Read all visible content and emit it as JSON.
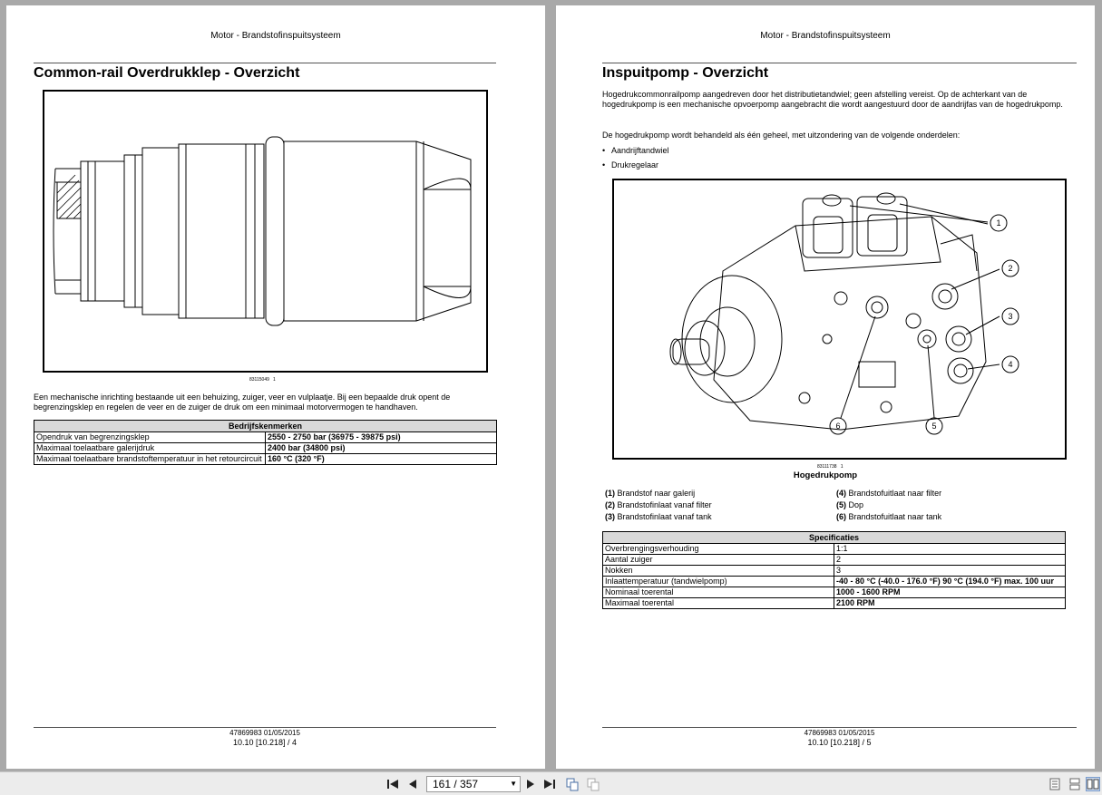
{
  "left_page": {
    "header": "Motor - Brandstofinspuitsysteem",
    "title": "Common-rail Overdrukklep - Overzicht",
    "figure_id": "83115049",
    "figure_num": "1",
    "paragraph": "Een mechanische inrichting bestaande uit een behuizing, zuiger, veer en vulplaatje. Bij een bepaalde druk opent de begrenzingsklep en regelen de veer en de zuiger de druk om een minimaal motorvermogen te handhaven.",
    "table": {
      "header": "Bedrijfskenmerken",
      "rows": [
        {
          "label": "Opendruk van begrenzingsklep",
          "value": "2550 - 2750 bar (36975 - 39875 psi)"
        },
        {
          "label": "Maximaal toelaatbare galerijdruk",
          "value": "2400 bar (34800 psi)"
        },
        {
          "label": "Maximaal toelaatbare brandstoftemperatuur in het retourcircuit",
          "value": "160 °C (320 °F)"
        }
      ]
    },
    "footer_id": "47869983 01/05/2015",
    "footer_page": "10.10 [10.218] / 4"
  },
  "right_page": {
    "header": "Motor - Brandstofinspuitsysteem",
    "title": "Inspuitpomp - Overzicht",
    "paragraph1": "Hogedrukcommonrailpomp aangedreven door het distributietandwiel; geen afstelling vereist.  Op de achterkant van de hogedrukpomp is een mechanische opvoerpomp aangebracht die wordt aangestuurd door de aandrijfas van de hogedrukpomp.",
    "paragraph2": "De hogedrukpomp wordt behandeld als één geheel, met uitzondering van de volgende onderdelen:",
    "bullets": [
      "Aandrijftandwiel",
      "Drukregelaar"
    ],
    "figure_id": "83111738",
    "figure_num": "1",
    "caption": "Hogedrukpomp",
    "callouts": [
      "1",
      "2",
      "3",
      "4",
      "5",
      "6"
    ],
    "legend": [
      {
        "num": "(1)",
        "text": "Brandstof naar galerij"
      },
      {
        "num": "(2)",
        "text": "Brandstofinlaat vanaf filter"
      },
      {
        "num": "(3)",
        "text": "Brandstofinlaat vanaf tank"
      },
      {
        "num": "(4)",
        "text": "Brandstofuitlaat naar filter"
      },
      {
        "num": "(5)",
        "text": "Dop"
      },
      {
        "num": "(6)",
        "text": "Brandstofuitlaat naar tank"
      }
    ],
    "table": {
      "header": "Specificaties",
      "rows": [
        {
          "label": "Overbrengingsverhouding",
          "value": "1:1",
          "bold": false
        },
        {
          "label": "Aantal zuiger",
          "value": "2",
          "bold": false
        },
        {
          "label": "Nokken",
          "value": "3",
          "bold": false
        },
        {
          "label": "Inlaattemperatuur (tandwielpomp)",
          "value": "-40 - 80 °C (-40.0 - 176.0 °F) 90 °C (194.0 °F) max. 100 uur",
          "bold": true
        },
        {
          "label": "Nominaal toerental",
          "value": "1000 - 1600 RPM",
          "bold": true
        },
        {
          "label": "Maximaal toerental",
          "value": "2100 RPM",
          "bold": true
        }
      ]
    },
    "footer_id": "47869983 01/05/2015",
    "footer_page": "10.10 [10.218] / 5"
  },
  "toolbar": {
    "page_indicator": "161 / 357",
    "icons": [
      "first-page-icon",
      "prev-page-icon",
      "next-page-icon",
      "last-page-icon",
      "copy-icon",
      "paste-icon",
      "single-page-icon",
      "continuous-page-icon",
      "two-page-icon"
    ]
  }
}
